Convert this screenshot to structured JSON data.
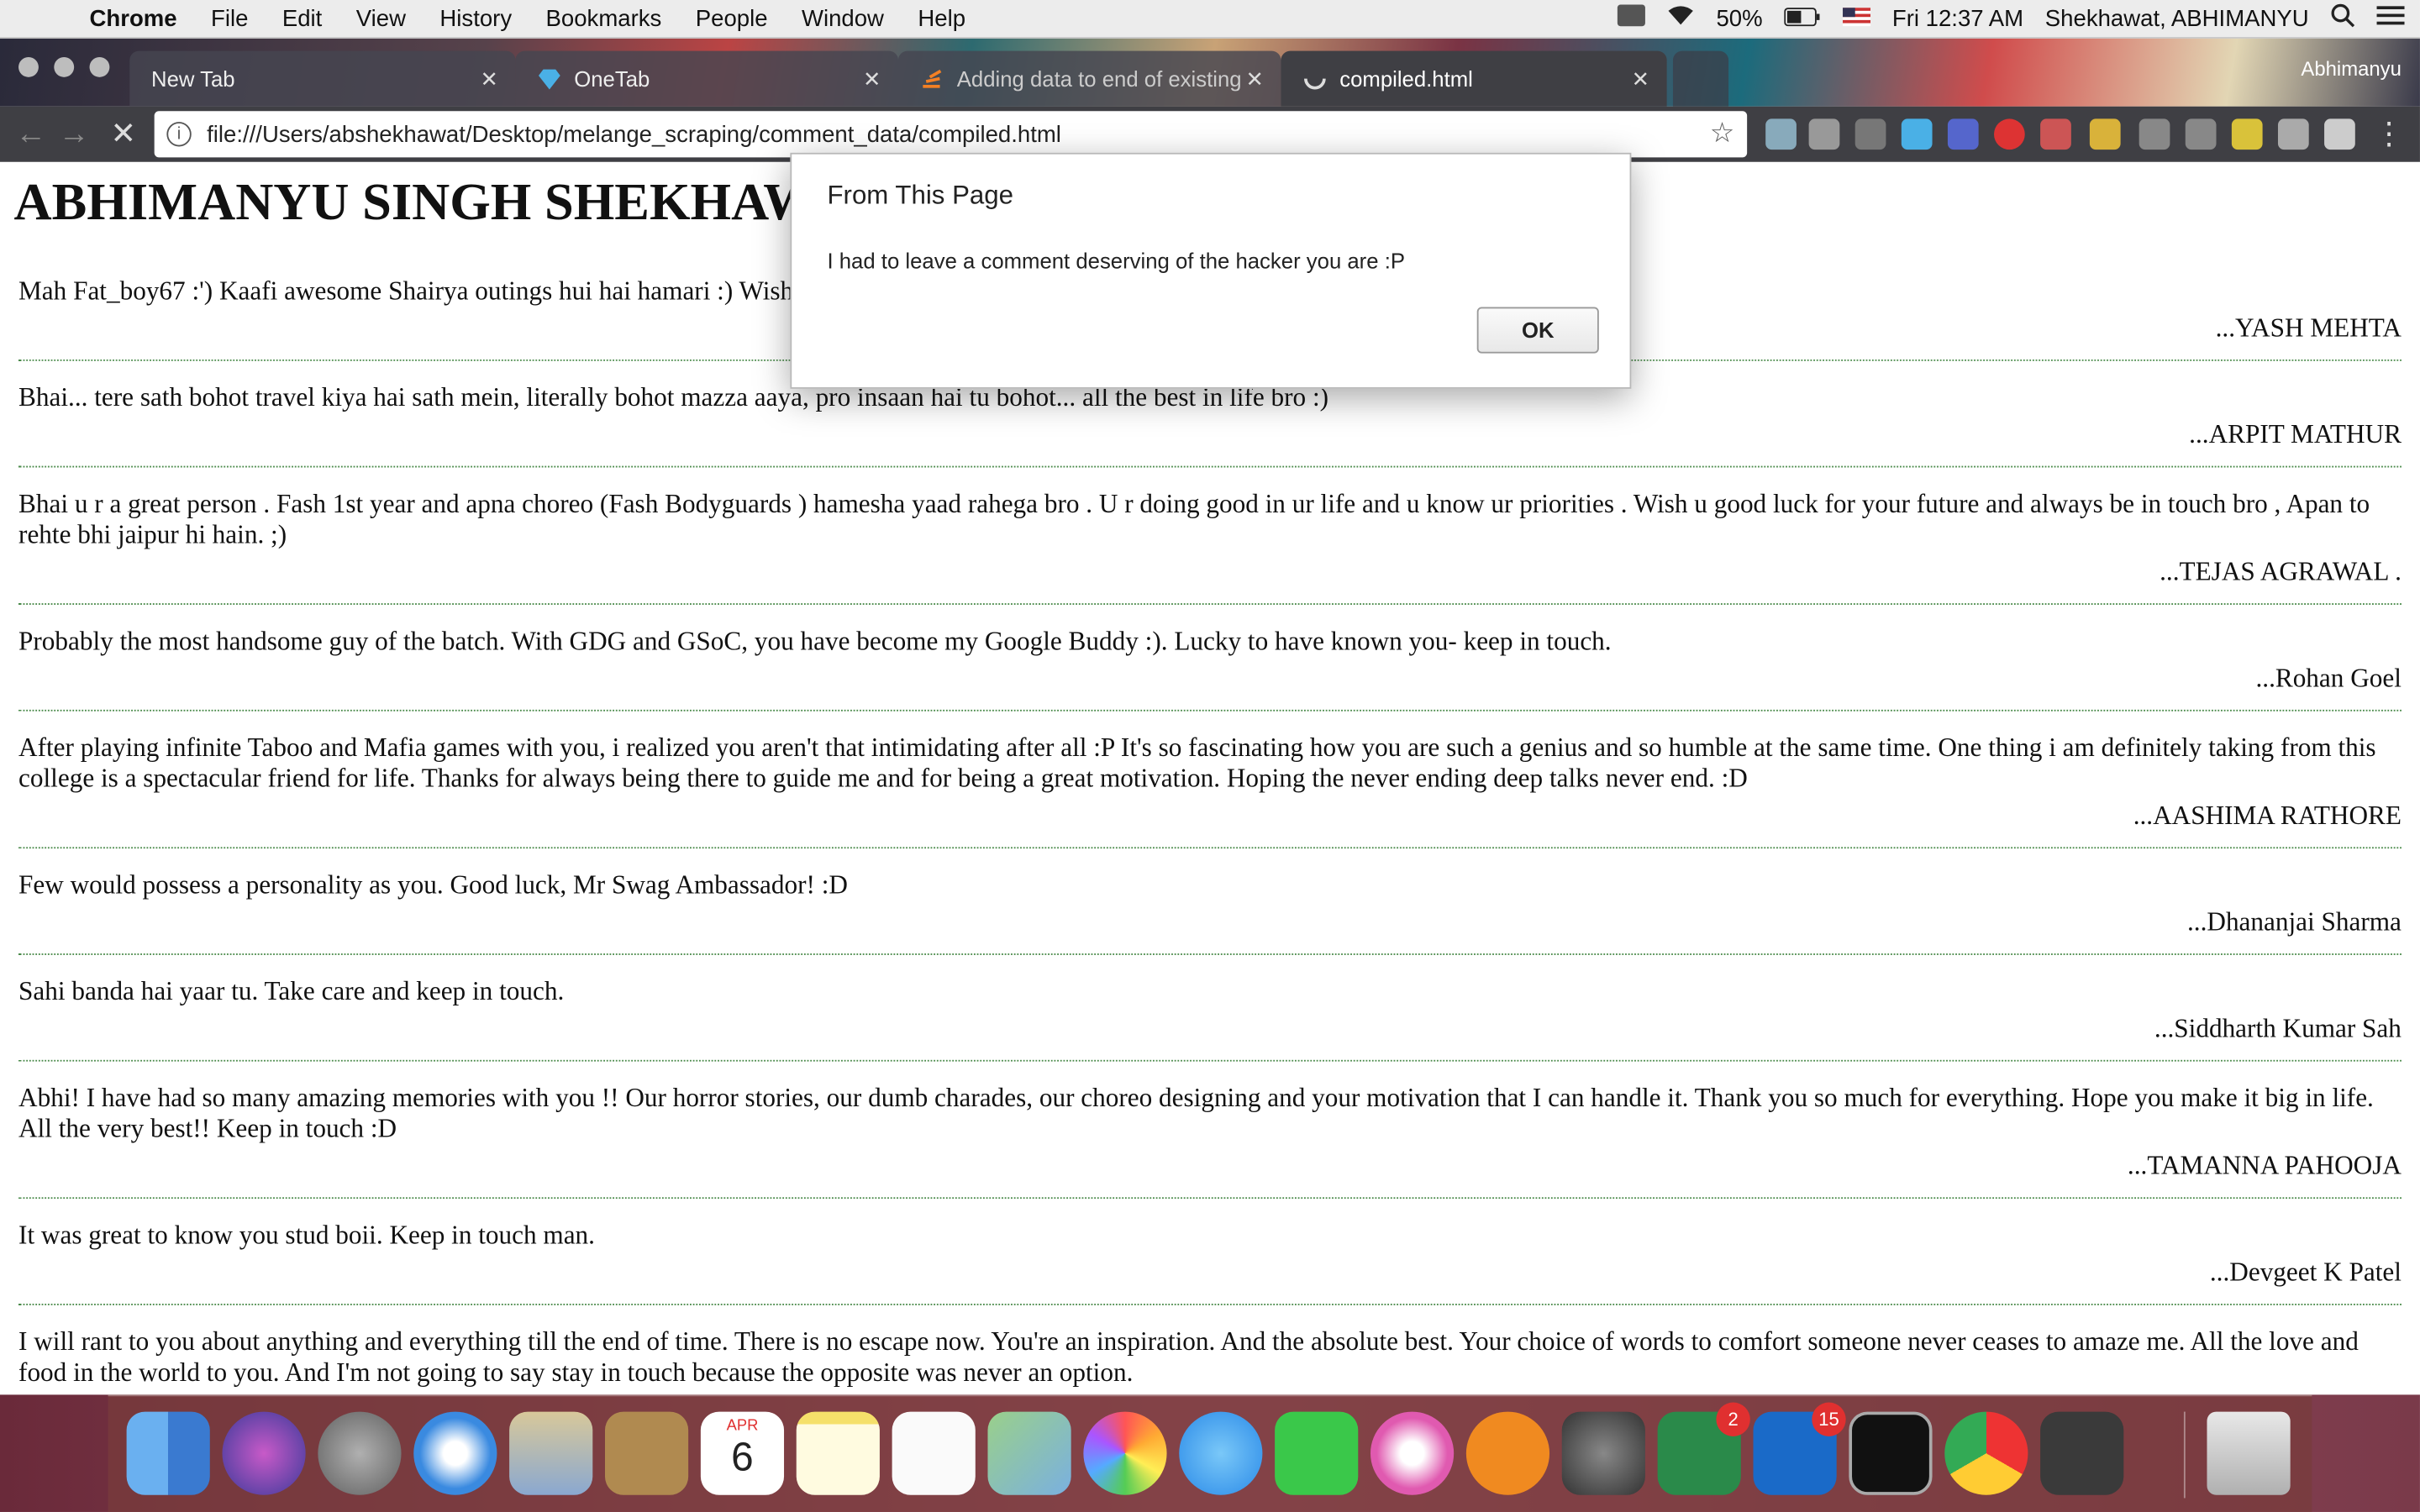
{
  "menubar": {
    "app": "Chrome",
    "items": [
      "File",
      "Edit",
      "View",
      "History",
      "Bookmarks",
      "People",
      "Window",
      "Help"
    ],
    "battery": "50%",
    "clock": "Fri 12:37 AM",
    "user": "Shekhawat, ABHIMANYU"
  },
  "tabs": [
    {
      "label": "New Tab"
    },
    {
      "label": "OneTab"
    },
    {
      "label": "Adding data to end of existing"
    },
    {
      "label": "compiled.html"
    }
  ],
  "profile_name": "Abhimanyu",
  "omnibox": {
    "url": "file:///Users/abshekhawat/Desktop/melange_scraping/comment_data/compiled.html"
  },
  "page": {
    "title": "ABHIMANYU SINGH SHEKHAWAT",
    "comments": [
      {
        "text": "Mah Fat_boy67 :') Kaafi awesome Shairya outings hui hai hamari :) Wish you all the best. Hope we stay in touch and have more outings in the future! :D",
        "author": "...YASH MEHTA"
      },
      {
        "text": "Bhai... tere sath bohot travel kiya hai sath mein, literally bohot mazza aaya, pro insaan hai tu bohot... all the best in life bro :)",
        "author": "...ARPIT MATHUR"
      },
      {
        "text": "Bhai u r a great person . Fash 1st year and apna choreo (Fash Bodyguards ) hamesha yaad rahega bro . U r doing good in ur life and u know ur priorities . Wish u good luck for your future and always be in touch bro , Apan to rehte bhi jaipur hi hain. ;)",
        "author": "...TEJAS AGRAWAL ."
      },
      {
        "text": "Probably the most handsome guy of the batch. With GDG and GSoC, you have become my Google Buddy :). Lucky to have known you- keep in touch.",
        "author": "...Rohan Goel"
      },
      {
        "text": "After playing infinite Taboo and Mafia games with you, i realized you aren't that intimidating after all :P It's so fascinating how you are such a genius and so humble at the same time. One thing i am definitely taking from this college is a spectacular friend for life. Thanks for always being there to guide me and for being a great motivation. Hoping the never ending deep talks never end. :D",
        "author": "...AASHIMA RATHORE"
      },
      {
        "text": "Few would possess a personality as you. Good luck, Mr Swag Ambassador! :D",
        "author": "...Dhananjai Sharma"
      },
      {
        "text": "Sahi banda hai yaar tu. Take care and keep in touch.",
        "author": "...Siddharth Kumar Sah"
      },
      {
        "text": "Abhi! I have had so many amazing memories with you !! Our horror stories, our dumb charades, our choreo designing and your motivation that I can handle it. Thank you so much for everything. Hope you make it big in life. All the very best!! Keep in touch :D",
        "author": "...TAMANNA PAHOOJA"
      },
      {
        "text": "It was great to know you stud boii. Keep in touch man.",
        "author": "...Devgeet K Patel"
      },
      {
        "text": "I will rant to you about anything and everything till the end of time. There is no escape now. You're an inspiration. And the absolute best. Your choice of words to comfort someone never ceases to amaze me. All the love and food in the world to you. And I'm not going to say stay in touch because the opposite was never an option.",
        "author": ""
      }
    ]
  },
  "dialog": {
    "title": "From This Page",
    "message": "I had to leave a comment deserving of the hacker you are :P",
    "ok_label": "OK"
  },
  "dock": {
    "calendar_month": "APR",
    "calendar_day": "6",
    "slack_badge": "2",
    "outlook_badge": "15"
  },
  "colors": {
    "toolbar": "#3f3f44",
    "divider": "#4a8a4a",
    "badge": "#e03030"
  }
}
